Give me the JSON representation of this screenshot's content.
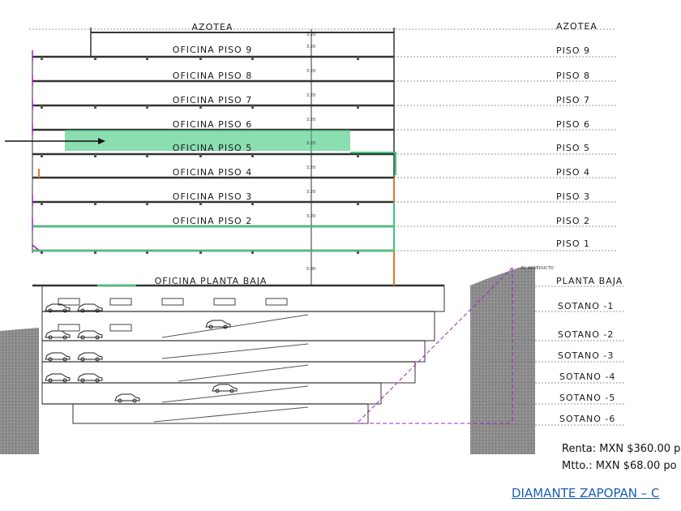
{
  "title_top": "AZOTEA",
  "floors": [
    {
      "label": "OFICINA PISO 9",
      "level": "PISO 9",
      "dim": "3.20"
    },
    {
      "label": "OFICINA PISO 8",
      "level": "PISO 8",
      "dim": "3.20"
    },
    {
      "label": "OFICINA PISO 7",
      "level": "PISO 7",
      "dim": "3.20"
    },
    {
      "label": "OFICINA PISO 6",
      "level": "PISO 6",
      "dim": "3.20"
    },
    {
      "label": "OFICINA PISO 5",
      "level": "PISO 5",
      "dim": "3.20"
    },
    {
      "label": "OFICINA PISO 4",
      "level": "PISO 4",
      "dim": "3.20"
    },
    {
      "label": "OFICINA PISO 3",
      "level": "PISO 3",
      "dim": "3.20"
    },
    {
      "label": "OFICINA PISO 2",
      "level": "PISO 2",
      "dim": "3.20"
    }
  ],
  "level_azotea": "AZOTEA",
  "level_piso1": "PISO 1",
  "ground_label": "OFICINA PLANTA BAJA",
  "level_ground": "PLANTA BAJA",
  "ground_dim": "5.00",
  "street_label": "AV. ACUEDUCTO",
  "basements": [
    "SOTANO -1",
    "SOTANO -2",
    "SOTANO -3",
    "SOTANO -4",
    "SOTANO -5",
    "SOTANO -6"
  ],
  "highlighted_floor": "PISO 5",
  "colors": {
    "highlight": "#3cc87a",
    "accent_orange": "#d9792a",
    "accent_purple": "#a020c0",
    "ground_fill": "#8c8c8c"
  },
  "price_rent": "Renta: MXN $360.00 p",
  "price_mtto": "Mtto.: MXN $68.00 po",
  "footer_link": "DIAMANTE ZAPOPAN – C"
}
